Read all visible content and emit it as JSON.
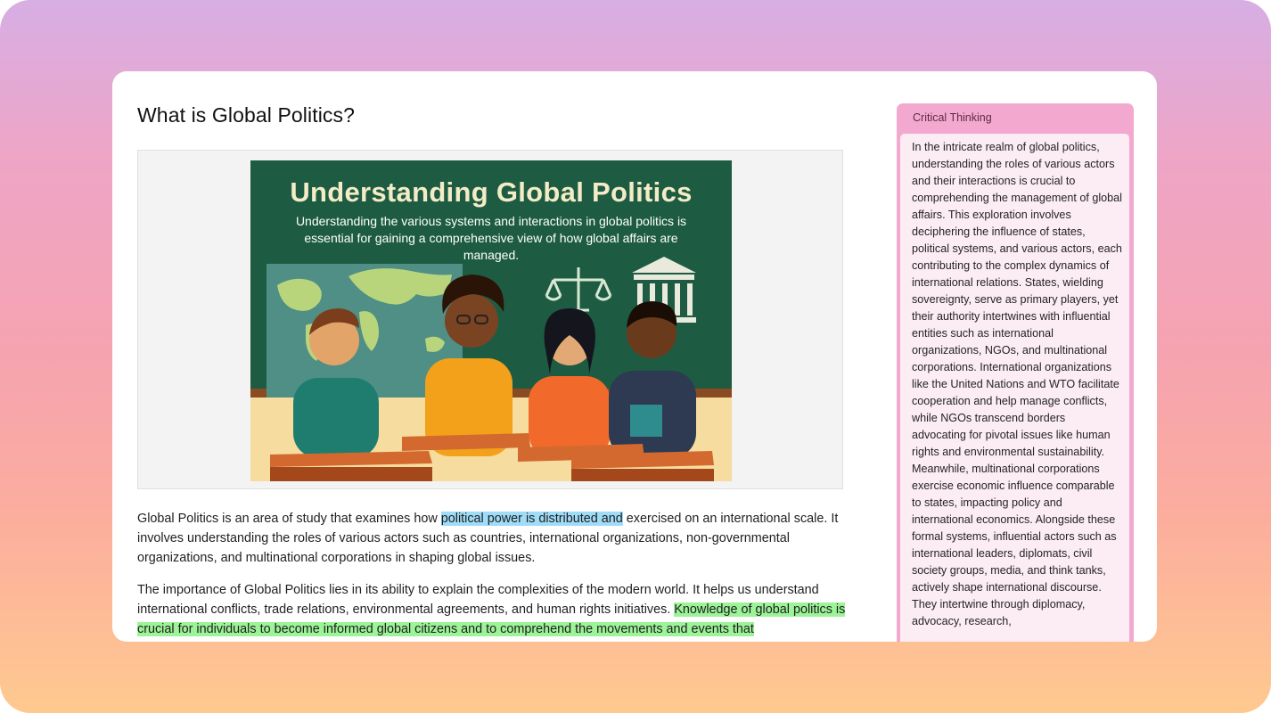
{
  "page": {
    "title": "What is Global Politics?"
  },
  "figure": {
    "heading": "Understanding Global Politics",
    "subheading": "Understanding the various systems and interactions in global politics is essential for gaining a comprehensive view of how global affairs are managed."
  },
  "content": {
    "p1_before": "Global Politics is an area of study that examines how ",
    "p1_highlight": "political power is distributed and",
    "p1_after": " exercised on an international scale. It involves understanding the roles of various actors such as countries, international organizations, non-governmental organizations, and multinational corporations in shaping global issues.",
    "p2_before": "The importance of Global Politics lies in its ability to explain the complexities of the modern world. It helps us understand international conflicts, trade relations, environmental agreements, and human rights initiatives. ",
    "p2_highlight": "Knowledge of global politics is crucial for individuals to become informed global citizens and to comprehend the movements and events that"
  },
  "sidebar": {
    "title": "Critical Thinking",
    "body": "In the intricate realm of global politics, understanding the roles of various actors and their interactions is crucial to comprehending the management of global affairs. This exploration involves deciphering the influence of states, political systems, and various actors, each contributing to the complex dynamics of international relations. States, wielding sovereignty, serve as primary players, yet their authority intertwines with influential entities such as international organizations, NGOs, and multinational corporations. International organizations like the United Nations and WTO facilitate cooperation and help manage conflicts, while NGOs transcend borders advocating for pivotal issues like human rights and environmental sustainability. Meanwhile, multinational corporations exercise economic influence comparable to states, impacting policy and international economics. Alongside these formal systems, influential actors such as international leaders, diplomats, civil society groups, media, and think tanks, actively shape international discourse. They intertwine through diplomacy, advocacy, research,"
  },
  "colors": {
    "highlight_blue": "#9fdcf7",
    "highlight_green": "#9cf398",
    "panel_accent": "#f3a9cf"
  }
}
